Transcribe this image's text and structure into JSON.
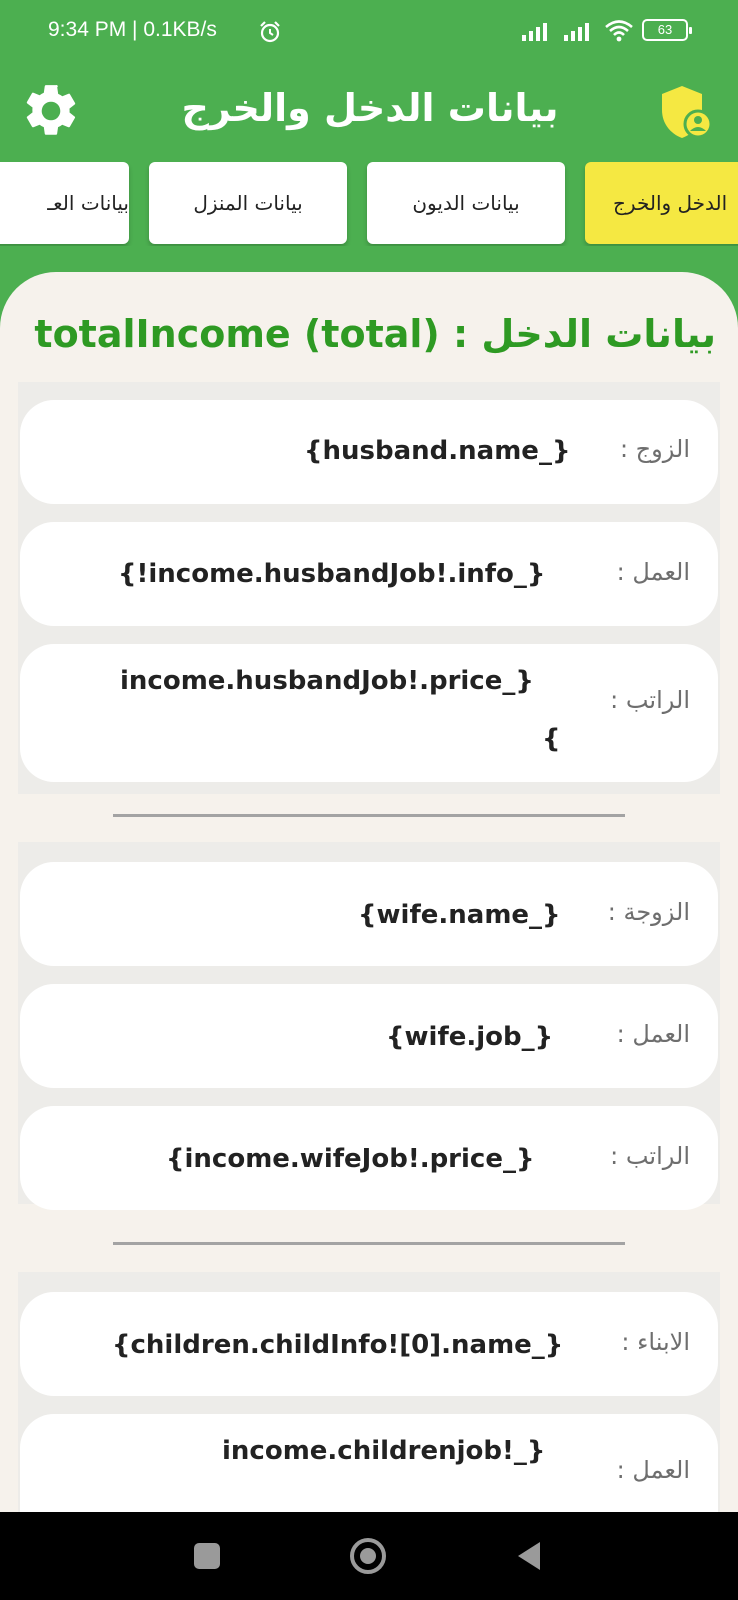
{
  "status_bar": {
    "time": "9:34 PM | 0.1KB/s",
    "battery": "63"
  },
  "app_bar": {
    "title": "بيانات الدخل والخرج"
  },
  "tabs": [
    {
      "label": "الدخل والخرج",
      "active": true
    },
    {
      "label": "بيانات الديون",
      "active": false
    },
    {
      "label": "بيانات المنزل",
      "active": false
    },
    {
      "label": "بيانات العـ",
      "active": false
    }
  ],
  "content": {
    "title": "بيانات الدخل : totalIncome (total)",
    "husband": {
      "name_label": "الزوج :",
      "name_value": "{husband.name_}",
      "job_label": "العمل :",
      "job_value": "{!income.husbandJob!.info_}",
      "salary_label": "الراتب :",
      "salary_value_line1": "income.husbandJob!.price_}",
      "salary_value_line2": "{"
    },
    "wife": {
      "name_label": "الزوجة :",
      "name_value": "{wife.name_}",
      "job_label": "العمل :",
      "job_value": "{wife.job_}",
      "salary_label": "الراتب :",
      "salary_value": "{income.wifeJob!.price_}"
    },
    "children": {
      "name_label": "الابناء :",
      "name_value": "{children.childInfo![0].name_}",
      "job_label": "العمل :",
      "job_value": "income.childrenjob!_}"
    }
  },
  "colors": {
    "primary": "#4CAF50",
    "accent_tab": "#F5E842",
    "title_green": "#2E9A23",
    "sheet_bg": "#F6F2EC"
  }
}
